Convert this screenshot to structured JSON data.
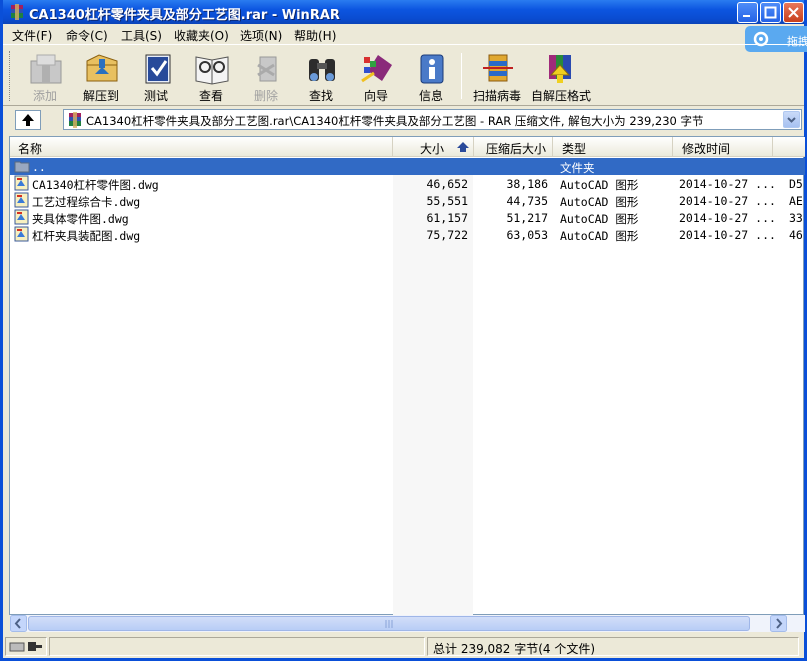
{
  "window": {
    "title": "CA1340杠杆零件夹具及部分工艺图.rar - WinRAR"
  },
  "baidu_badge": {
    "label": "拖拽"
  },
  "menu": [
    {
      "label": "文件(F)"
    },
    {
      "label": "命令(C)"
    },
    {
      "label": "工具(S)"
    },
    {
      "label": "收藏夹(O)"
    },
    {
      "label": "选项(N)"
    },
    {
      "label": "帮助(H)"
    }
  ],
  "toolbar": [
    {
      "label": "添加",
      "icon": "add-icon",
      "enabled": false
    },
    {
      "label": "解压到",
      "icon": "extract-to-icon",
      "enabled": true
    },
    {
      "label": "测试",
      "icon": "test-icon",
      "enabled": true
    },
    {
      "label": "查看",
      "icon": "view-icon",
      "enabled": true
    },
    {
      "label": "删除",
      "icon": "delete-icon",
      "enabled": false
    },
    {
      "label": "查找",
      "icon": "find-icon",
      "enabled": true
    },
    {
      "label": "向导",
      "icon": "wizard-icon",
      "enabled": true
    },
    {
      "label": "信息",
      "icon": "info-icon",
      "enabled": true
    },
    {
      "label": "扫描病毒",
      "icon": "scan-virus-icon",
      "enabled": true
    },
    {
      "label": "自解压格式",
      "icon": "sfx-icon",
      "enabled": true
    }
  ],
  "address": {
    "path": "CA1340杠杆零件夹具及部分工艺图.rar\\CA1340杠杆零件夹具及部分工艺图 - RAR 压缩文件, 解包大小为 239,230 字节"
  },
  "columns": {
    "name": "名称",
    "size": "大小",
    "packed": "压缩后大小",
    "type": "类型",
    "modified": "修改时间"
  },
  "parent_row": {
    "name": "..",
    "type": "文件夹"
  },
  "files": [
    {
      "name": "CA1340杠杆零件图.dwg",
      "size": "46,652",
      "packed": "38,186",
      "type": "AutoCAD 图形",
      "modified": "2014-10-27 ...",
      "crc": "D5"
    },
    {
      "name": "工艺过程综合卡.dwg",
      "size": "55,551",
      "packed": "44,735",
      "type": "AutoCAD 图形",
      "modified": "2014-10-27 ...",
      "crc": "AE"
    },
    {
      "name": "夹具体零件图.dwg",
      "size": "61,157",
      "packed": "51,217",
      "type": "AutoCAD 图形",
      "modified": "2014-10-27 ...",
      "crc": "33"
    },
    {
      "name": "杠杆夹具装配图.dwg",
      "size": "75,722",
      "packed": "63,053",
      "type": "AutoCAD 图形",
      "modified": "2014-10-27 ...",
      "crc": "46"
    }
  ],
  "status": {
    "total": "总计 239,082 字节(4 个文件)"
  }
}
